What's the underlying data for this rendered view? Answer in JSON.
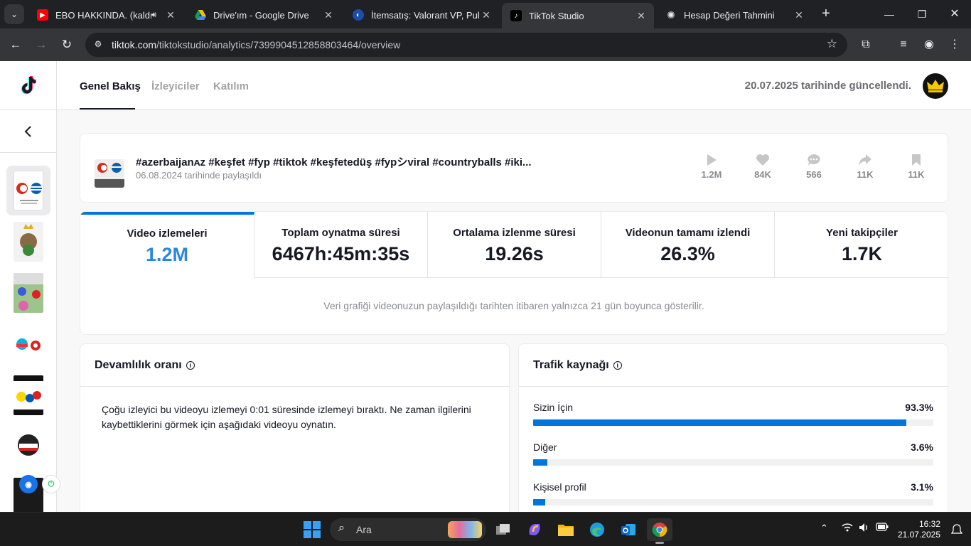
{
  "browser": {
    "tabs": [
      {
        "title": "EBO HAKKINDA. (kaldırıl",
        "favicon": "youtube-icon",
        "audio": true,
        "active": false
      },
      {
        "title": "Drive'ım - Google Drive",
        "favicon": "google-drive-icon",
        "audio": false,
        "active": false
      },
      {
        "title": "İtemsatış: Valorant VP, Pubg",
        "favicon": "itemsatis-icon",
        "audio": false,
        "active": false
      },
      {
        "title": "TikTok Studio",
        "favicon": "tiktok-icon",
        "audio": false,
        "active": true
      },
      {
        "title": "Hesap Değeri Tahmini",
        "favicon": "chatgpt-icon",
        "audio": false,
        "active": false
      }
    ],
    "url_host": "tiktok.com",
    "url_path": "/tiktokstudio/analytics/7399904512858803464/overview"
  },
  "header": {
    "tabs": [
      "Genel Bakış",
      "İzleyiciler",
      "Katılım"
    ],
    "updated_text": "20.07.2025 tarihinde güncellendi."
  },
  "video": {
    "title": "#azerbaijanᴀᴢ #keşfet #fyp #tiktok #keşfetedüş #fypシviral #countryballs #iki...",
    "date": "06.08.2024 tarihinde paylaşıldı",
    "stats": {
      "views": "1.2M",
      "likes": "84K",
      "comments": "566",
      "shares": "11K",
      "saves": "11K"
    }
  },
  "metrics": [
    {
      "label": "Video izlemeleri",
      "value": "1.2M"
    },
    {
      "label": "Toplam oynatma süresi",
      "value": "6467h:45m:35s"
    },
    {
      "label": "Ortalama izlenme süresi",
      "value": "19.26s"
    },
    {
      "label": "Videonun tamamı izlendi",
      "value": "26.3%"
    },
    {
      "label": "Yeni takipçiler",
      "value": "1.7K"
    }
  ],
  "metrics_note": "Veri grafiği videonuzun paylaşıldığı tarihten itibaren yalnızca 21 gün boyunca gösterilir.",
  "retention": {
    "title": "Devamlılık oranı",
    "text": "Çoğu izleyici bu videoyu izlemeyi 0:01 süresinde izlemeyi bıraktı. Ne zaman ilgilerini kaybettiklerini görmek için aşağıdaki videoyu oynatın."
  },
  "traffic": {
    "title": "Trafik kaynağı",
    "sources": [
      {
        "label": "Sizin İçin",
        "value": "93.3%",
        "fraction": 0.933
      },
      {
        "label": "Diğer",
        "value": "3.6%",
        "fraction": 0.036
      },
      {
        "label": "Kişisel profil",
        "value": "3.1%",
        "fraction": 0.031
      }
    ]
  },
  "taskbar": {
    "search_placeholder": "Ara",
    "time": "16:32",
    "date": "21.07.2025"
  },
  "colors": {
    "accent": "#0075db",
    "selected_value": "#2a87e0"
  }
}
